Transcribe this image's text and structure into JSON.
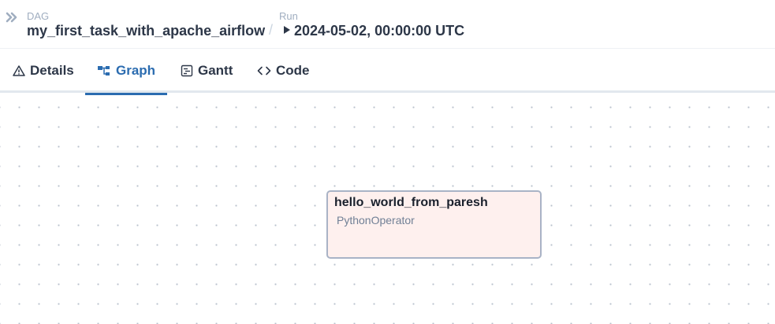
{
  "breadcrumb": {
    "dag_label": "DAG",
    "dag_id": "my_first_task_with_apache_airflow",
    "separator": "/",
    "run_label": "Run",
    "run_id": "2024-05-02, 00:00:00 UTC"
  },
  "tabs": [
    {
      "label": "Details",
      "icon": "warning-triangle-icon",
      "active": false
    },
    {
      "label": "Graph",
      "icon": "graph-icon",
      "active": true
    },
    {
      "label": "Gantt",
      "icon": "gantt-icon",
      "active": false
    },
    {
      "label": "Code",
      "icon": "code-icon",
      "active": false
    }
  ],
  "graph": {
    "nodes": [
      {
        "task_id": "hello_world_from_paresh",
        "operator": "PythonOperator"
      }
    ]
  },
  "colors": {
    "accent": "#2b6cb0",
    "node_background": "#fef0ee",
    "node_border": "#a9b3c6"
  }
}
